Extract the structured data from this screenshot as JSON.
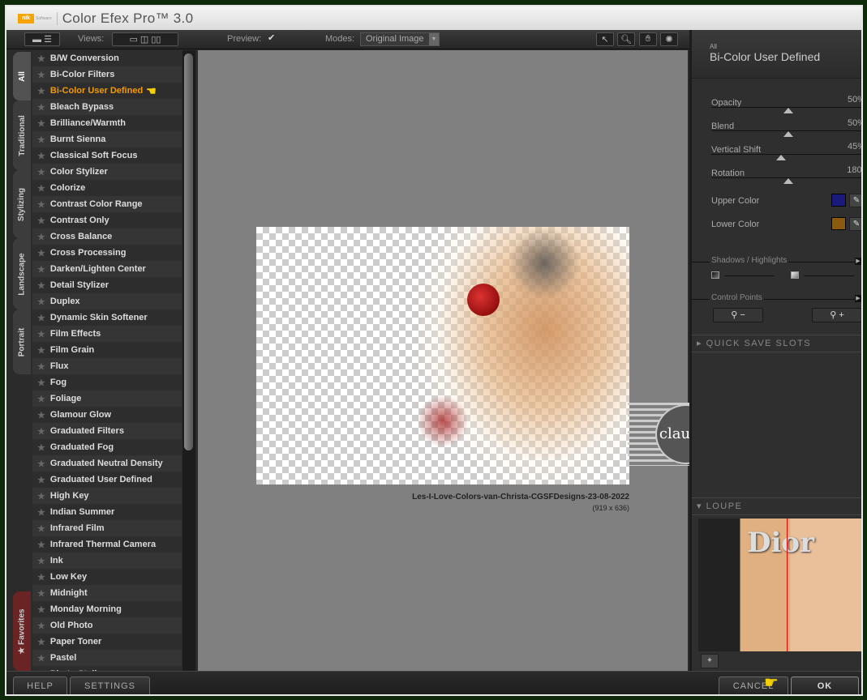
{
  "app": {
    "title": "Color Efex Pro™ 3.0",
    "logo": "nik Software"
  },
  "toolbar": {
    "views_label": "Views:",
    "preview_label": "Preview:",
    "preview_checked": true,
    "modes_label": "Modes:",
    "mode_value": "Original Image",
    "check": "✔",
    "tools": [
      "select-arrow",
      "zoom",
      "hand",
      "light"
    ]
  },
  "tabs": [
    {
      "label": "All",
      "active": true
    },
    {
      "label": "Traditional"
    },
    {
      "label": "Stylizing"
    },
    {
      "label": "Landscape"
    },
    {
      "label": "Portrait"
    },
    {
      "label": "Favorites"
    }
  ],
  "filters": [
    "B/W Conversion",
    "Bi-Color Filters",
    "Bi-Color User Defined",
    "Bleach Bypass",
    "Brilliance/Warmth",
    "Burnt Sienna",
    "Classical Soft Focus",
    "Color Stylizer",
    "Colorize",
    "Contrast Color Range",
    "Contrast Only",
    "Cross Balance",
    "Cross Processing",
    "Darken/Lighten Center",
    "Detail Stylizer",
    "Duplex",
    "Dynamic Skin Softener",
    "Film Effects",
    "Film Grain",
    "Flux",
    "Fog",
    "Foliage",
    "Glamour Glow",
    "Graduated Filters",
    "Graduated Fog",
    "Graduated Neutral Density",
    "Graduated User Defined",
    "High Key",
    "Indian Summer",
    "Infrared Film",
    "Infrared Thermal Camera",
    "Ink",
    "Low Key",
    "Midnight",
    "Monday Morning",
    "Old Photo",
    "Paper Toner",
    "Pastel",
    "Photo Stylizer"
  ],
  "selected_filter": "Bi-Color User Defined",
  "preview": {
    "filename": "Les-I-Love-Colors-van-Christa-CGSFDesigns-23-08-2022",
    "dimensions": "(919 x 636)",
    "watermark": "claudia"
  },
  "panel": {
    "category": "All",
    "title": "Bi-Color User Defined",
    "sliders": [
      {
        "label": "Opacity",
        "value": "50%",
        "level": 0.5
      },
      {
        "label": "Blend",
        "value": "50%",
        "level": 0.5
      },
      {
        "label": "Vertical Shift",
        "value": "45%",
        "level": 0.45
      },
      {
        "label": "Rotation",
        "value": "180°",
        "level": 0.5
      }
    ],
    "upper_color_label": "Upper Color",
    "upper_color": "#1a1a7a",
    "lower_color_label": "Lower Color",
    "lower_color": "#8a5a10",
    "shadows_label": "Shadows / Highlights",
    "control_points_label": "Control Points",
    "cp_remove": "−",
    "cp_add": "+",
    "quick_save": "QUICK SAVE SLOTS",
    "loupe": "LOUPE",
    "loupe_text": "Dior"
  },
  "footer": {
    "help": "HELP",
    "settings": "SETTINGS",
    "cancel": "CANCEL",
    "ok": "OK"
  }
}
